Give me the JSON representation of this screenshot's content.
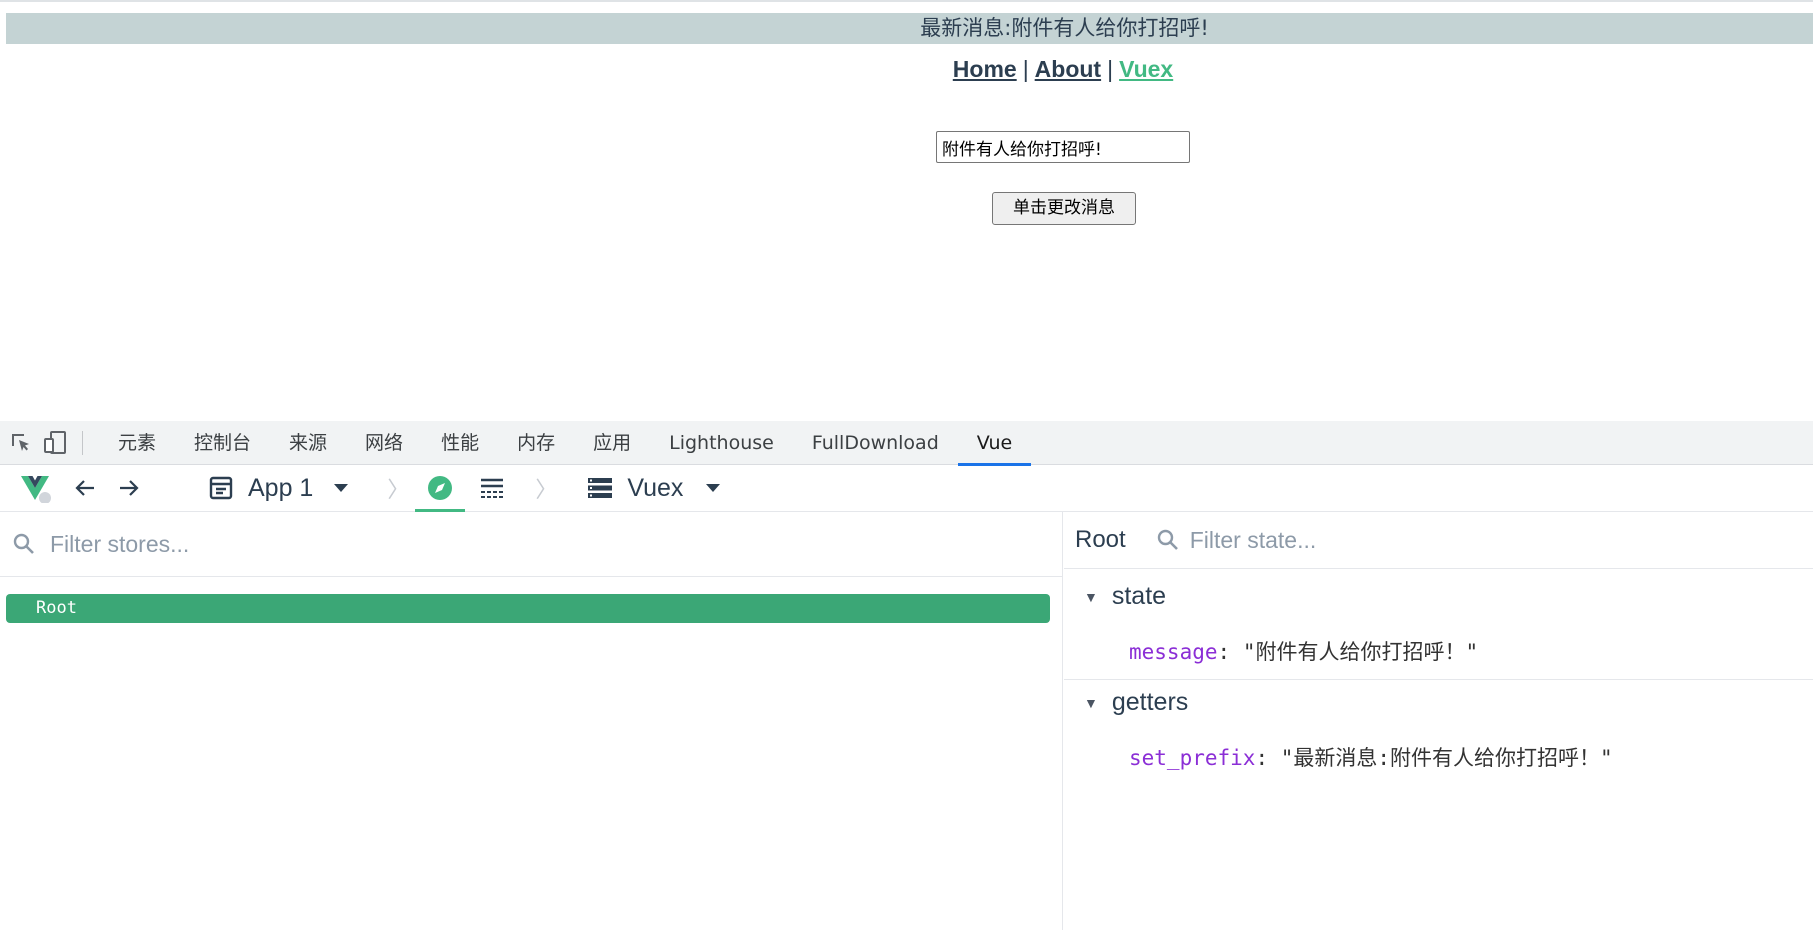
{
  "page": {
    "banner_text": "最新消息:附件有人给你打招呼!",
    "nav": {
      "home": "Home",
      "about": "About",
      "vuex": "Vuex",
      "separator": "|"
    },
    "message_input_value": "附件有人给你打招呼!",
    "change_button_label": "单击更改消息"
  },
  "devtools": {
    "tabs": [
      "元素",
      "控制台",
      "来源",
      "网络",
      "性能",
      "内存",
      "应用",
      "Lighthouse",
      "FullDownload",
      "Vue"
    ],
    "selected_tab": "Vue",
    "vue_toolbar": {
      "app_selector": "App 1",
      "inspector_selector": "Vuex",
      "icons": [
        "vue-logo-icon",
        "back-arrow-icon",
        "forward-arrow-icon",
        "app-window-icon",
        "compass-icon",
        "timeline-icon",
        "stack-icon"
      ]
    },
    "stores_filter_placeholder": "Filter stores...",
    "stores": [
      "Root"
    ],
    "state_panel": {
      "title": "Root",
      "filter_placeholder": "Filter state...",
      "sections": [
        {
          "label": "state",
          "entries": [
            {
              "key": "message",
              "value": "\"附件有人给你打招呼！\""
            }
          ]
        },
        {
          "label": "getters",
          "entries": [
            {
              "key": "set_prefix",
              "value": "\"最新消息:附件有人给你打招呼！\""
            }
          ]
        }
      ]
    },
    "colors": {
      "vue_green": "#42b983",
      "active_row": "#3ba776",
      "tab_underline": "#1a73e8",
      "key_color": "#8b2ed6"
    }
  }
}
